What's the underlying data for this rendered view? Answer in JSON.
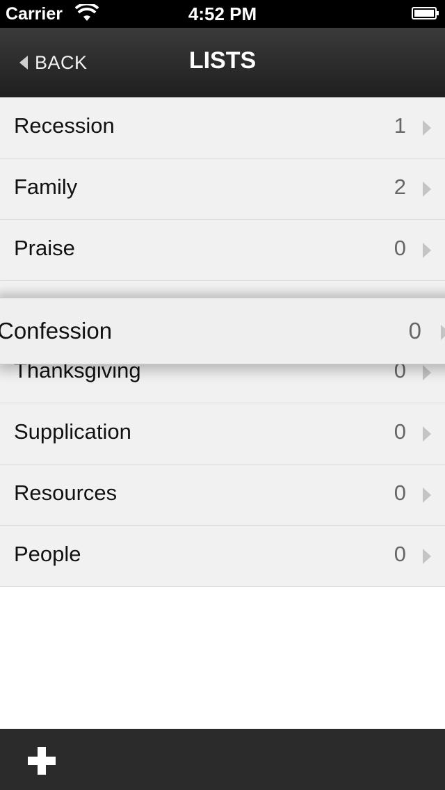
{
  "status_bar": {
    "carrier": "Carrier",
    "time": "4:52 PM",
    "icons": [
      "wifi-icon",
      "battery-icon"
    ]
  },
  "nav": {
    "back_label": "BACK",
    "title": "LISTS"
  },
  "list": {
    "rows": [
      {
        "label": "Recession",
        "count": "1"
      },
      {
        "label": "Family",
        "count": "2"
      },
      {
        "label": "Praise",
        "count": "0"
      },
      {
        "label": "Thanksgiving",
        "count": "0"
      },
      {
        "label": "Supplication",
        "count": "0"
      },
      {
        "label": "Resources",
        "count": "0"
      },
      {
        "label": "People",
        "count": "0"
      }
    ],
    "dragging_row": {
      "label": "Confession",
      "count": "0"
    }
  },
  "toolbar": {
    "add_icon": "plus-icon"
  },
  "colors": {
    "row_background": "#f1f1f1",
    "nav_background": "#2a2a2a",
    "toolbar_background": "#2b2b2b",
    "chevron": "#c4c4c4"
  }
}
